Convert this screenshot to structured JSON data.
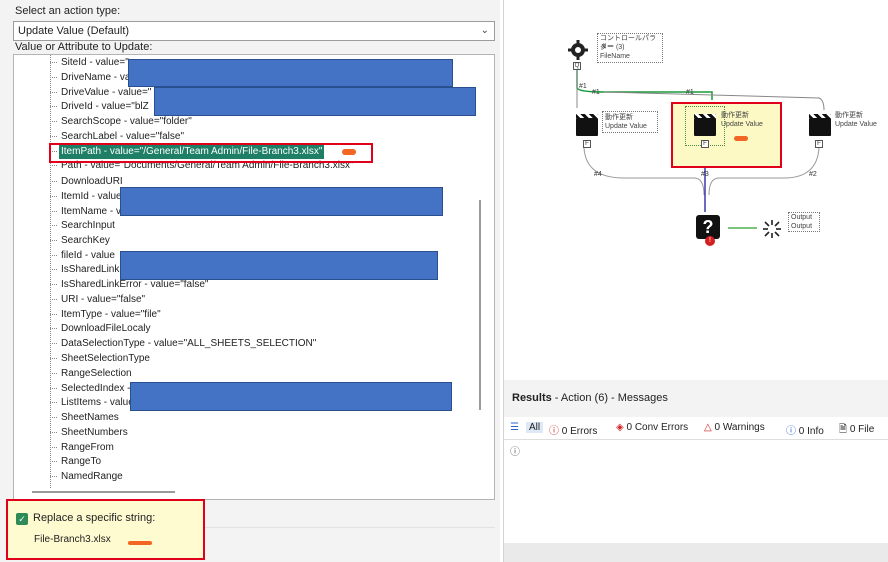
{
  "left": {
    "action_type_label": "Select an action type:",
    "action_type_value": "Update Value (Default)",
    "update_label": "Value or Attribute to Update:",
    "tree_items": [
      "SiteId - value=\"",
      "DriveName - val",
      "DriveValue - value=\"",
      "DriveId - value=\"blZ",
      "SearchScope - value=\"folder\"",
      "SearchLabel - value=\"false\"",
      "ItemPath - value=\"/General/Team Admin/File-Branch3.xlsx\"",
      "Path - value=\"Documents/General/Team Admin/File-Branch3.xlsx\"",
      "DownloadURI",
      "ItemId - value",
      "ItemName - va",
      "SearchInput",
      "SearchKey",
      "fileId - value",
      "IsSharedLink",
      "IsSharedLinkError - value=\"false\"",
      "URI - value=\"false\"",
      "ItemType - value=\"file\"",
      "DownloadFileLocaly",
      "DataSelectionType - value=\"ALL_SHEETS_SELECTION\"",
      "SheetSelectionType",
      "RangeSelection",
      "SelectedIndex -",
      "ListItems - value",
      "SheetNames",
      "SheetNumbers",
      "RangeFrom",
      "RangeTo",
      "NamedRange"
    ],
    "replace_label": "Replace a specific string:",
    "replace_value": "File-Branch3.xlsx",
    "check_glyph": "✓"
  },
  "canvas": {
    "control_param_label_1": "コントロールパラメー",
    "control_param_label_2": "ター (3)",
    "control_param_label_3": "FileName",
    "action1_label_1": "動作更新",
    "action1_label_2": "Update Value",
    "action2_label_1": "動作更新",
    "action2_label_2": "Update Value",
    "action3_label_1": "動作更新",
    "action3_label_2": "Update Value",
    "output_label_1": "Output",
    "output_label_2": "Output",
    "conn_1": "#1",
    "conn_1b": "#1",
    "conn_1c": "#1",
    "conn_2": "#2",
    "conn_3": "#3",
    "conn_4": "#4",
    "anchor_f": "F",
    "anchor_q": "Q",
    "question_glyph": "?",
    "error_glyph": "!"
  },
  "results": {
    "title": "Results",
    "subtitle": " - Action (6) - Messages",
    "all": "All",
    "errors": "0 Errors",
    "conv_errors": "0 Conv Errors",
    "warnings": "0 Warnings",
    "info": "0 Info",
    "files": "0 File"
  },
  "colors": {
    "redaction": "#4472c4",
    "highlight_border": "#e0001a",
    "selection": "#1e7f66",
    "replace_bg": "#fefbd0"
  }
}
